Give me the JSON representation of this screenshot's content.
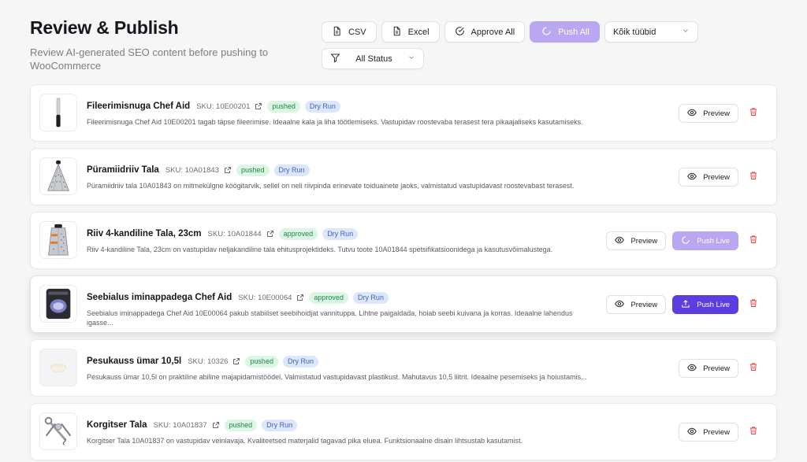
{
  "header": {
    "title": "Review & Publish",
    "subtitle": "Review AI-generated SEO content before pushing to WooCommerce"
  },
  "toolbar": {
    "csv_label": "CSV",
    "excel_label": "Excel",
    "approve_all_label": "Approve All",
    "push_all_label": "Push All",
    "type_filter_value": "Kõik tüübid",
    "status_filter_value": "All Status"
  },
  "colors": {
    "accent": "#5b3de0",
    "accent_light": "#b9a7f2",
    "pushed_badge": "#dcf5e5",
    "dry_run_badge": "#dde7fb",
    "delete_red": "#e5484d"
  },
  "common": {
    "preview_label": "Preview",
    "push_live_label": "Push Live"
  },
  "products": [
    {
      "name": "Fileerimisnuga Chef Aid",
      "sku": "SKU: 10E00201",
      "status": "pushed",
      "mode": "Dry Run",
      "description": "Fileerimisnuga Chef Aid 10E00201 tagab täpse fileerimise. Ideaalne kala ja liha töötlemiseks. Vastupidav roostevaba terasest tera pikaajaliseks kasutamiseks.",
      "image_icon": "knife-icon"
    },
    {
      "name": "Püramiidriiv Tala",
      "sku": "SKU: 10A01843",
      "status": "pushed",
      "mode": "Dry Run",
      "description": "Püramiidriiv tala 10A01843 on mitmekülgne köögitarvik, sellel on neli riivpinda erinevate toiduainete jaoks, valmistatud vastupidavast roostevabast terasest.",
      "image_icon": "pyramid-grater-icon"
    },
    {
      "name": "Riiv 4-kandiline Tala, 23cm",
      "sku": "SKU: 10A01844",
      "status": "approved",
      "mode": "Dry Run",
      "description": "Riiv 4-kandiline Tala, 23cm on vastupidav neljakandiline tala ehitusprojektideks. Tutvu toote 10A01844 spetsifikatsioonidega ja kasutusvõimalustega.",
      "image_icon": "box-grater-icon"
    },
    {
      "name": "Seebialus iminappadega Chef Aid",
      "sku": "SKU: 10E00064",
      "status": "approved",
      "mode": "Dry Run",
      "description": "Seebialus iminappadega Chef Aid 10E00064 pakub stabiilset seebihoidjat vannituppa. Lihtne paigaldada, hoiab seebi kuivana ja korras. Ideaalne lahendus igasse...",
      "image_icon": "soap-dish-icon"
    },
    {
      "name": "Pesukauss ümar 10,5l",
      "sku": "SKU: 10326",
      "status": "pushed",
      "mode": "Dry Run",
      "description": "Pesukauss ümar 10,5l on praktiline abiline majapidamistöödel. Valmistatud vastupidavast plastikust. Mahutavus 10,5 liitrit. Ideaalne pesemiseks ja hoiustamis...",
      "image_icon": "basin-icon"
    },
    {
      "name": "Korgitser Tala",
      "sku": "SKU: 10A01837",
      "status": "pushed",
      "mode": "Dry Run",
      "description": "Korgitser Tala 10A01837 on vastupidav veiniavaja. Kvaliteetsed materjalid tagavad pika eluea. Funktsionaalne disain lihtsustab kasutamist.",
      "image_icon": "corkscrew-icon"
    }
  ]
}
